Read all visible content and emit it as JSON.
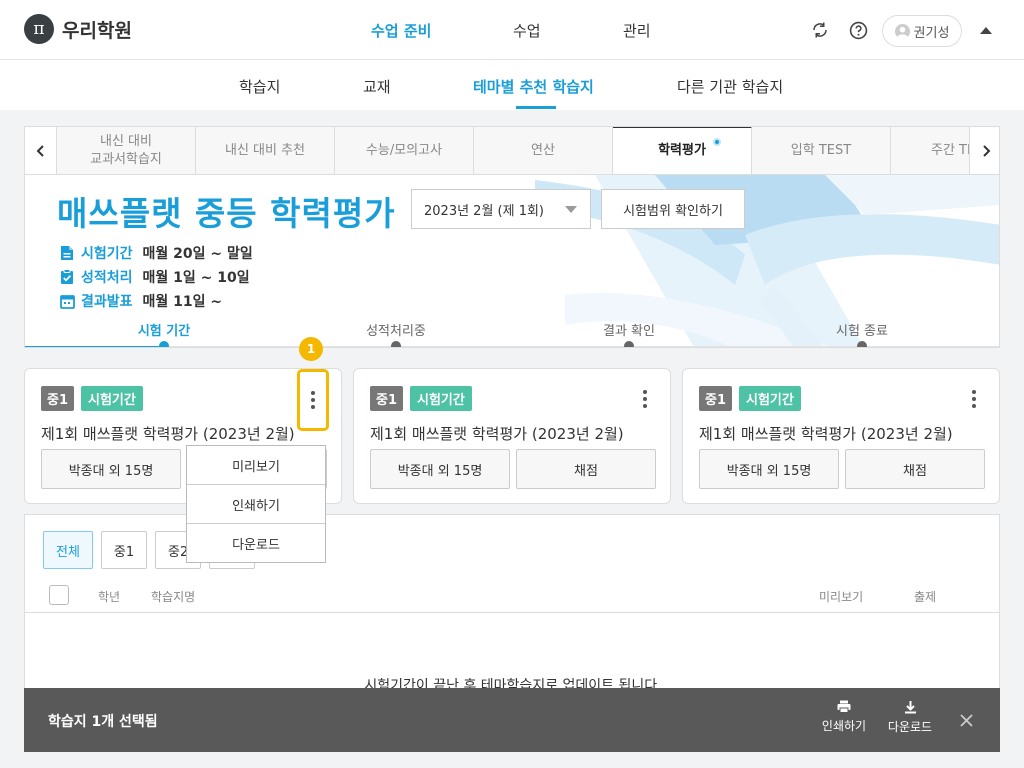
{
  "header": {
    "logo_symbol": "π",
    "logo_text": "우리학원",
    "nav": [
      "수업 준비",
      "수업",
      "관리"
    ],
    "active_nav": "수업 준비",
    "user_name": "권기성"
  },
  "subnav": {
    "items": [
      "학습지",
      "교재",
      "테마별 추천 학습지",
      "다른 기관 학습지"
    ],
    "active": "테마별 추천 학습지"
  },
  "tabs": {
    "items": [
      {
        "label": "내신 대비\n교과서학습지"
      },
      {
        "label": "내신 대비 추천"
      },
      {
        "label": "수능/모의고사"
      },
      {
        "label": "연산"
      },
      {
        "label": "학력평가",
        "active": true,
        "new": true
      },
      {
        "label": "입학 TEST"
      },
      {
        "label": "주간 TI"
      }
    ]
  },
  "hero": {
    "title": "매쓰플랫 중등 학력평가",
    "select_value": "2023년 2월 (제 1회)",
    "range_button": "시험범위 확인하기",
    "info": [
      {
        "label": "시험기간",
        "value": "매월 20일 ~ 말일",
        "icon": "document-icon"
      },
      {
        "label": "성적처리",
        "value": "매월 1일 ~ 10일",
        "icon": "clipboard-check-icon"
      },
      {
        "label": "결과발표",
        "value": "매월 11일 ~",
        "icon": "calendar-icon"
      }
    ],
    "steps": [
      "시험 기간",
      "성적처리중",
      "결과 확인",
      "시험 종료"
    ],
    "active_step": 0
  },
  "cards": [
    {
      "grade": "중1",
      "status": "시험기간",
      "title": "제1회 매쓰플랫 학력평가 (2023년 2월)",
      "students": "박종대 외 15명",
      "grade_btn": "채점"
    },
    {
      "grade": "중1",
      "status": "시험기간",
      "title": "제1회 매쓰플랫 학력평가 (2023년 2월)",
      "students": "박종대 외 15명",
      "grade_btn": "채점"
    },
    {
      "grade": "중1",
      "status": "시험기간",
      "title": "제1회 매쓰플랫 학력평가 (2023년 2월)",
      "students": "박종대 외 15명",
      "grade_btn": "채점"
    }
  ],
  "marker": "1",
  "menu": [
    "미리보기",
    "인쇄하기",
    "다운로드"
  ],
  "list": {
    "filters": [
      "전체",
      "중1",
      "중2",
      ""
    ],
    "active_filter": "전체",
    "columns": {
      "grade": "학년",
      "name": "학습지명",
      "preview": "미리보기",
      "assign": "출제"
    },
    "empty_message": "시험기간이 끝난 후 테마학습지로 업데이트 됩니다."
  },
  "action_bar": {
    "selected_text": "학습지 1개 선택됨",
    "print_label": "인쇄하기",
    "download_label": "다운로드"
  },
  "colors": {
    "accent": "#1a9ed9",
    "status_green": "#4ec2a5",
    "highlight": "#f5b800"
  }
}
